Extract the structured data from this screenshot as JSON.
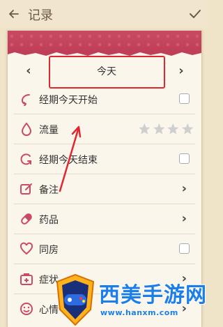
{
  "header": {
    "title": "记录",
    "back_icon": "arrow-left-icon",
    "confirm_icon": "check-icon"
  },
  "date_nav": {
    "prev": "‹",
    "label": "今天",
    "next": "›"
  },
  "rows": [
    {
      "label": "经期今天开始",
      "icon": "period-start-icon",
      "control": "checkbox"
    },
    {
      "label": "流量",
      "icon": "drop-icon",
      "control": "stars",
      "rating": 0,
      "max": 5
    },
    {
      "label": "经期今天结束",
      "icon": "period-end-icon",
      "control": "checkbox"
    },
    {
      "label": "备注",
      "icon": "edit-icon",
      "control": "chevron"
    },
    {
      "label": "药品",
      "icon": "pill-icon",
      "control": "chevron"
    },
    {
      "label": "同房",
      "icon": "heart-icon",
      "control": "checkbox"
    },
    {
      "label": "症状",
      "icon": "medkit-icon",
      "control": "chevron"
    },
    {
      "label": "心情",
      "icon": "smile-icon",
      "control": "chevron"
    }
  ],
  "watermark": {
    "title": "西美手游网",
    "url": "www.hanxm.com"
  },
  "colors": {
    "accent": "#c94a63",
    "highlight_box": "#e0262f",
    "watermark": "#1c7ee8"
  }
}
